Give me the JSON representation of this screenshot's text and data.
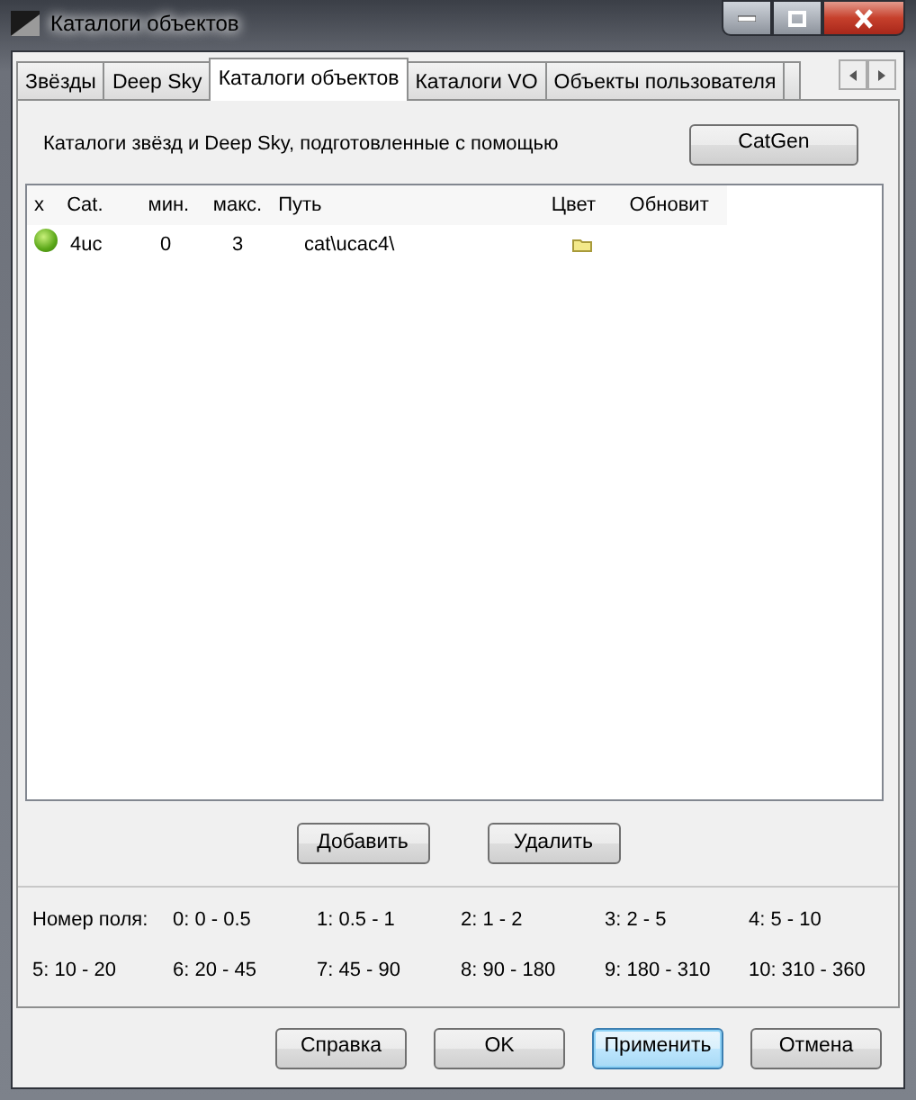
{
  "window": {
    "title": "Каталоги объектов"
  },
  "tabs": [
    {
      "label": "Звёзды",
      "selected": false
    },
    {
      "label": "Deep Sky",
      "selected": false
    },
    {
      "label": "Каталоги объектов",
      "selected": true
    },
    {
      "label": "Каталоги VO",
      "selected": false
    },
    {
      "label": "Объекты пользователя",
      "selected": false
    }
  ],
  "description": "Каталоги звёзд и Deep Sky, подготовленные с помощью",
  "catgen_button": "CatGen",
  "table": {
    "columns": [
      "x",
      "Cat.",
      "мин.",
      "макс.",
      "Путь",
      "Цвет",
      "Обновит"
    ],
    "rows": [
      {
        "active": true,
        "cat": "4uc",
        "min": "0",
        "max": "3",
        "path": "cat\\ucac4\\"
      }
    ]
  },
  "list_buttons": [
    "Добавить",
    "Удалить"
  ],
  "field_label": "Номер поля:",
  "fields": [
    "0: 0 - 0.5",
    "1: 0.5 - 1",
    "2: 1 - 2",
    "3: 2 - 5",
    "4: 5 - 10",
    "5: 10 - 20",
    "6: 20 - 45",
    "7: 45 - 90",
    "8: 90 - 180",
    "9: 180 - 310",
    "10: 310 - 360"
  ],
  "buttons": [
    {
      "label": "Справка",
      "default": false
    },
    {
      "label": "OK",
      "default": false
    },
    {
      "label": "Применить",
      "default": true
    },
    {
      "label": "Отмена",
      "default": false
    }
  ]
}
